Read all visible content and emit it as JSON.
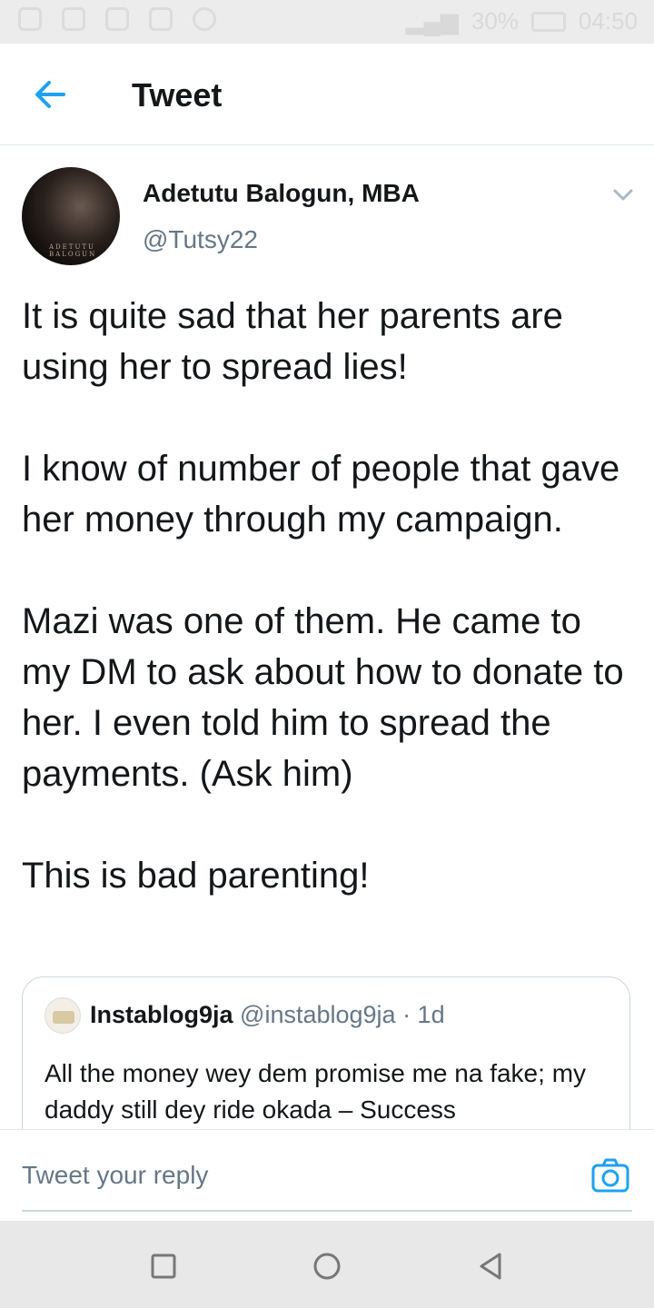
{
  "status_bar": {
    "battery": "30%",
    "time": "04:50",
    "icons": [
      "volume-icon",
      "notes-icon",
      "mail-icon",
      "image-icon",
      "whatsapp-icon",
      "call-icon",
      "alarm-icon",
      "signal-icon",
      "wifi-icon"
    ]
  },
  "header": {
    "title": "Tweet",
    "back_icon": "arrow-left-icon"
  },
  "author": {
    "name": "Adetutu Balogun, MBA",
    "handle": "@Tutsy22",
    "avatar_caption": "ADETUTU BALOGUN"
  },
  "tweet": {
    "paragraphs": [
      "It is quite sad that her parents are using her to spread lies!",
      "I know of number of people that gave her money through my campaign.",
      "Mazi was one of them. He came to my DM to ask about how to donate to her. I even told him to spread the payments. (Ask him)",
      "This is bad parenting!"
    ]
  },
  "quote": {
    "name": "Instablog9ja",
    "handle": "@instablog9ja · 1d",
    "text": "All the money wey dem promise me na fake; my daddy still dey ride okada – Success"
  },
  "reply": {
    "placeholder": "Tweet your reply",
    "camera_icon": "camera-icon"
  },
  "nav": {
    "buttons": [
      "recents-square-icon",
      "home-circle-icon",
      "back-triangle-icon"
    ]
  },
  "colors": {
    "accent": "#1da1f2",
    "text": "#14171a",
    "secondary": "#657786",
    "border": "#e1e8ed"
  }
}
